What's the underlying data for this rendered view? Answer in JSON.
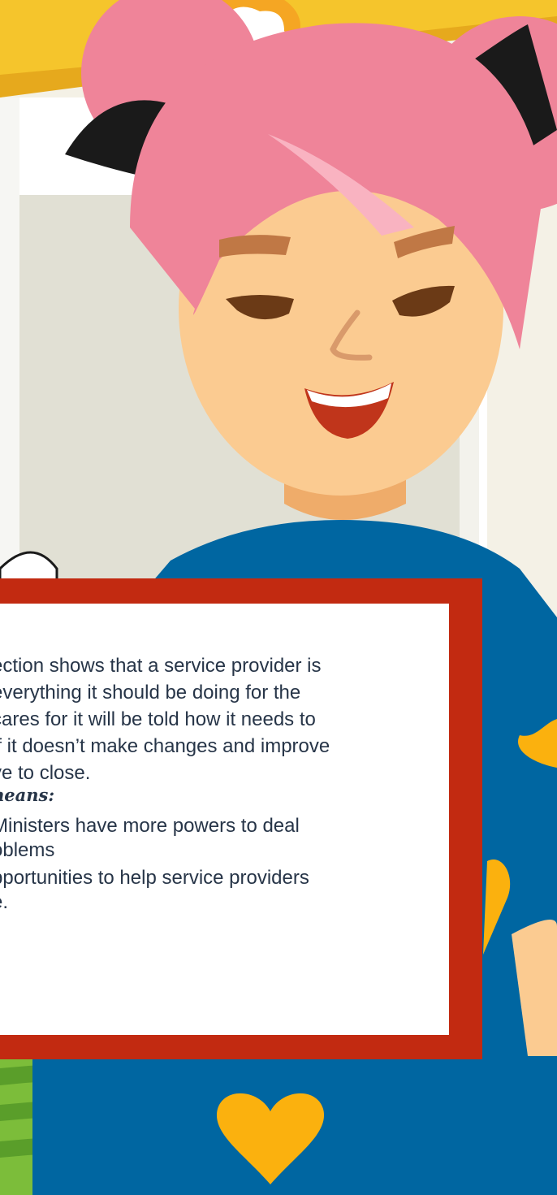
{
  "colors": {
    "hair": "#ef8499",
    "skin": "#fbcb91",
    "shirt": "#0066a1",
    "heart": "#fbb10e",
    "frame": "#c22a11",
    "text": "#273548"
  },
  "card": {
    "paragraph_lines": [
      "ection shows that a service provider is",
      "everything it should be doing for the",
      "cares for it will be told how it needs to",
      "lf it doesn’t make changes and improve",
      "ve to close."
    ],
    "heading": "neans:",
    "bullets": [
      {
        "lines": [
          "Ministers have more powers to deal",
          "oblems"
        ]
      },
      {
        "lines": [
          "pportunities to help service providers",
          "e."
        ]
      }
    ]
  }
}
